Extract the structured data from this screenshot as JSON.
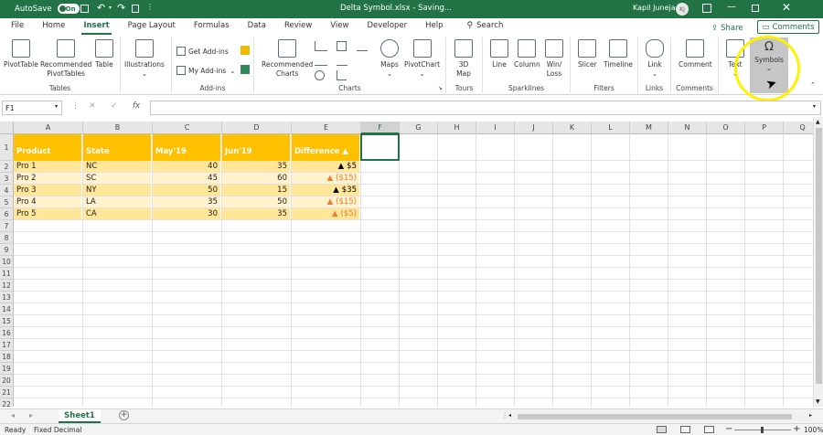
{
  "titlebar": {
    "autosave_label": "AutoSave",
    "autosave_state": "On",
    "doc_title": "Delta Symbol.xlsx  -  Saving...",
    "user_name": "Kapil Juneja",
    "user_initials": "KJ"
  },
  "ribbon_tabs": [
    "File",
    "Home",
    "Insert",
    "Page Layout",
    "Formulas",
    "Data",
    "Review",
    "View",
    "Developer",
    "Help"
  ],
  "active_tab": "Insert",
  "search_label": "Search",
  "share_label": "Share",
  "comments_label": "Comments",
  "ribbon": {
    "tables": {
      "label": "Tables",
      "pivottable": "PivotTable",
      "recommended_pivot_1": "Recommended",
      "recommended_pivot_2": "PivotTables",
      "table": "Table"
    },
    "illustrations": {
      "label": "Illustrations"
    },
    "addins": {
      "label": "Add-ins",
      "get_addins": "Get Add-ins",
      "my_addins": "My Add-ins"
    },
    "charts": {
      "label": "Charts",
      "recommended_1": "Recommended",
      "recommended_2": "Charts",
      "maps": "Maps",
      "pivotchart": "PivotChart"
    },
    "tours": {
      "label": "Tours",
      "map3d_1": "3D",
      "map3d_2": "Map"
    },
    "sparklines": {
      "label": "Sparklines",
      "line": "Line",
      "column": "Column",
      "winloss_1": "Win/",
      "winloss_2": "Loss"
    },
    "filters": {
      "label": "Filters",
      "slicer": "Slicer",
      "timeline": "Timeline"
    },
    "links": {
      "label": "Links",
      "link": "Link"
    },
    "comments": {
      "label": "Comments",
      "comment": "Comment"
    },
    "text": {
      "label": "Text"
    },
    "symbols": {
      "label": "Symbols",
      "omega": "Ω"
    }
  },
  "formula_bar": {
    "name_box": "F1",
    "fx": "fx",
    "formula": ""
  },
  "columns": [
    "A",
    "B",
    "C",
    "D",
    "E",
    "F",
    "G",
    "H",
    "I",
    "J",
    "K",
    "L",
    "M",
    "N",
    "O",
    "P",
    "Q"
  ],
  "selected_column": "F",
  "rows": [
    "1",
    "2",
    "3",
    "4",
    "5",
    "6",
    "7",
    "8",
    "9",
    "10",
    "11",
    "12",
    "13",
    "14",
    "15",
    "16",
    "17",
    "18",
    "19",
    "20",
    "21",
    "22"
  ],
  "table": {
    "headers": [
      "Product",
      "State",
      "May'19",
      "Jun'19",
      "Difference ▲"
    ],
    "rows": [
      {
        "product": "Pro 1",
        "state": "NC",
        "may": "40",
        "jun": "35",
        "diff": "▲ $5"
      },
      {
        "product": "Pro 2",
        "state": "SC",
        "may": "45",
        "jun": "60",
        "diff": "▲ ($15)"
      },
      {
        "product": "Pro 3",
        "state": "NY",
        "may": "50",
        "jun": "15",
        "diff": "▲ $35"
      },
      {
        "product": "Pro 4",
        "state": "LA",
        "may": "35",
        "jun": "50",
        "diff": "▲ ($15)"
      },
      {
        "product": "Pro 5",
        "state": "CA",
        "may": "30",
        "jun": "35",
        "diff": "▲ ($5)"
      }
    ]
  },
  "colors": {
    "header_fill": "#FFC000",
    "row_fill_light": "#FFF2CC",
    "row_fill_dark": "#FFE699",
    "accent_green": "#217346",
    "neg_triangle": "#ED7D31",
    "highlight_circle": "#FFF200"
  },
  "sheet_tab": "Sheet1",
  "status": {
    "ready": "Ready",
    "fixed_decimal": "Fixed Decimal",
    "zoom": "100%"
  }
}
